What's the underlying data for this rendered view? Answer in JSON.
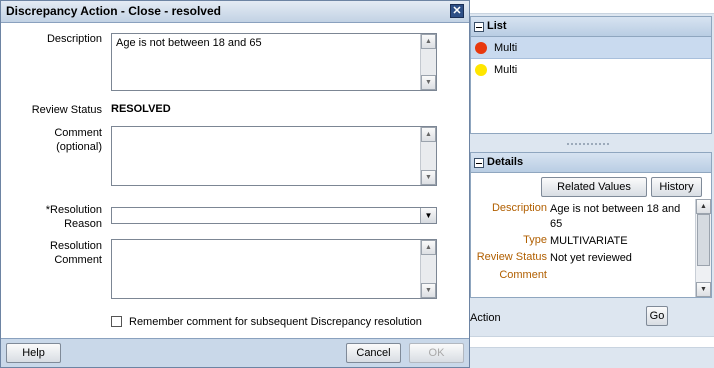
{
  "dialog": {
    "title": "Discrepancy Action - Close - resolved",
    "close_glyph": "✕",
    "description_label": "Description",
    "description_value": "Age is not between 18 and 65",
    "review_status_label": "Review Status",
    "review_status_value": "RESOLVED",
    "comment_label_line1": "Comment",
    "comment_label_line2": "(optional)",
    "comment_value": "",
    "resolution_reason_label_line1": "*Resolution",
    "resolution_reason_label_line2": "Reason",
    "resolution_reason_value": "",
    "resolution_comment_label_line1": "Resolution",
    "resolution_comment_label_line2": "Comment",
    "resolution_comment_value": "",
    "remember_label": "Remember comment for subsequent Discrepancy resolution",
    "remember_checked": false,
    "help_label": "Help",
    "cancel_label": "Cancel",
    "ok_label": "OK"
  },
  "list_pane": {
    "title": "List",
    "items": [
      {
        "label": "Multi",
        "color": "#e8380d",
        "selected": true
      },
      {
        "label": "Multi",
        "color": "#ffe600",
        "selected": false
      }
    ]
  },
  "details_pane": {
    "title": "Details",
    "related_values_label": "Related Values",
    "history_label": "History",
    "fields": [
      {
        "label": "Description",
        "value": "Age is not between 18 and 65"
      },
      {
        "label": "Type",
        "value": "MULTIVARIATE"
      },
      {
        "label": "Review Status",
        "value": "Not yet reviewed"
      },
      {
        "label": "Comment",
        "value": ""
      }
    ]
  },
  "action": {
    "label": "Action",
    "go_label": "Go"
  },
  "icons": {
    "scroll_up": "▲",
    "scroll_down": "▼",
    "dropdown": "▼"
  },
  "colors": {
    "label_accent": "#b15f00",
    "dialog_border": "#6d84a3",
    "footer_bg": "#c9d8e9"
  }
}
